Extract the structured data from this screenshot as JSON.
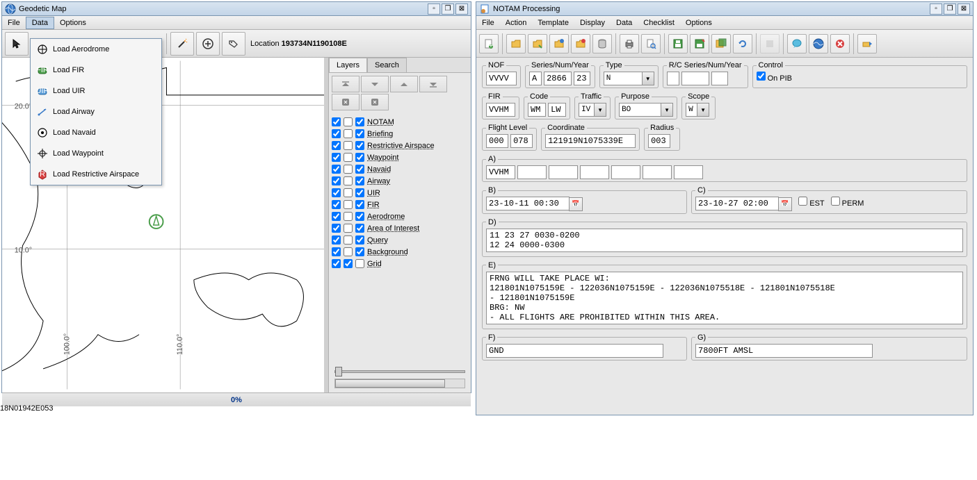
{
  "geodetic": {
    "title": "Geodetic Map",
    "menu": {
      "file": "File",
      "data": "Data",
      "options": "Options"
    },
    "location_label": "Location",
    "location_value": " 193734N1190108E",
    "status": "0%",
    "dropdown": {
      "aerodrome": "Load Aerodrome",
      "fir": "Load FIR",
      "uir": "Load UIR",
      "airway": "Load Airway",
      "navaid": "Load Navaid",
      "waypoint": "Load Waypoint",
      "restrictive": "Load Restrictive Airspace"
    },
    "tabs": {
      "layers": "Layers",
      "search": "Search"
    },
    "layers": [
      {
        "c1": true,
        "c2": false,
        "c3": true,
        "label": "NOTAM"
      },
      {
        "c1": true,
        "c2": false,
        "c3": true,
        "label": "Briefing"
      },
      {
        "c1": true,
        "c2": false,
        "c3": true,
        "label": "Restrictive Airspace"
      },
      {
        "c1": true,
        "c2": false,
        "c3": true,
        "label": "Waypoint"
      },
      {
        "c1": true,
        "c2": false,
        "c3": true,
        "label": "Navaid"
      },
      {
        "c1": true,
        "c2": false,
        "c3": true,
        "label": "Airway"
      },
      {
        "c1": true,
        "c2": false,
        "c3": true,
        "label": "UIR"
      },
      {
        "c1": true,
        "c2": false,
        "c3": true,
        "label": "FIR"
      },
      {
        "c1": true,
        "c2": false,
        "c3": true,
        "label": "Aerodrome"
      },
      {
        "c1": true,
        "c2": false,
        "c3": true,
        "label": "Area of Interest"
      },
      {
        "c1": true,
        "c2": false,
        "c3": true,
        "label": "Query"
      },
      {
        "c1": true,
        "c2": false,
        "c3": true,
        "label": "Background"
      },
      {
        "c1": true,
        "c2": true,
        "c3": false,
        "label": "Grid"
      }
    ],
    "map_ticks_y": [
      "20.0°",
      "10.0°"
    ],
    "map_ticks_x": [
      "100.0°",
      "110.0°"
    ]
  },
  "notam": {
    "title": "NOTAM Processing",
    "menu": {
      "file": "File",
      "action": "Action",
      "template": "Template",
      "display": "Display",
      "data": "Data",
      "checklist": "Checklist",
      "options": "Options"
    },
    "nof_label": "NOF",
    "nof": "VVVV",
    "series_label": "Series/Num/Year",
    "series": "A",
    "num": "2866",
    "year": "23",
    "type_label": "Type",
    "type": "N",
    "rc_label": "R/C Series/Num/Year",
    "control_label": "Control",
    "on_pib": "On PIB",
    "fir_label": "FIR",
    "fir": "VVHM",
    "code_label": "Code",
    "code1": "WM",
    "code2": "LW",
    "traffic_label": "Traffic",
    "traffic": "IV",
    "purpose_label": "Purpose",
    "purpose": "BO",
    "scope_label": "Scope",
    "scope": "W",
    "fl_label": "Flight Level",
    "fl1": "000",
    "fl2": "078",
    "coord_label": "Coordinate",
    "coord": "121919N1075339E",
    "radius_label": "Radius",
    "radius": "003",
    "a_label": "A)",
    "a_val": "VVHM",
    "b_label": "B)",
    "b_val": "23-10-11 00:30",
    "c_label": "C)",
    "c_val": "23-10-27 02:00",
    "est": "EST",
    "perm": "PERM",
    "d_label": "D)",
    "d_val": "11 23 27 0030-0200\n12 24 0000-0300",
    "e_label": "E)",
    "e_val": "FRNG WILL TAKE PLACE WI:\n121801N1075159E - 122036N1075159E - 122036N1075518E - 121801N1075518E\n- 121801N1075159E\nBRG: NW\n- ALL FLIGHTS ARE PROHIBITED WITHIN THIS AREA.",
    "f_label": "F)",
    "f_val": "GND",
    "g_label": "G)",
    "g_val": "7800FT AMSL"
  },
  "bottom_coord": "18N01942E053"
}
